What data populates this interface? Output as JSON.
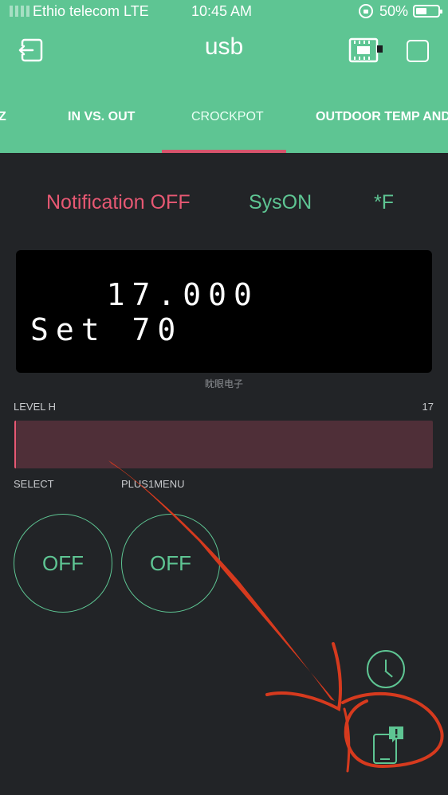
{
  "status_bar": {
    "carrier": "Ethio telecom LTE",
    "time": "10:45 AM",
    "battery": "50%"
  },
  "header": {
    "title": "usb",
    "icons": [
      "exit-icon",
      "device-icon",
      "add-widget-icon"
    ]
  },
  "tabs": [
    {
      "label": "Z"
    },
    {
      "label": "IN VS. OUT"
    },
    {
      "label": "CROCKPOT",
      "active": true
    },
    {
      "label": "OUTDOOR TEMP AND"
    }
  ],
  "status_labels": {
    "notification": "Notification OFF",
    "system": "SysON",
    "unit": "*F"
  },
  "lcd": {
    "line1": "   17.000",
    "line2": "Set 70",
    "caption": "眈眼电子"
  },
  "level": {
    "label": "LEVEL H",
    "value": "17",
    "fill_fraction": 0.004
  },
  "buttons": [
    {
      "label": "SELECT",
      "state": "OFF"
    },
    {
      "label": "PLUS1MENU",
      "state": "OFF"
    }
  ],
  "colors": {
    "header_bg": "#5ec593",
    "app_bg": "#222427",
    "accent_red": "#e75873",
    "accent_green": "#5ec593",
    "annotation_red": "#d63a1e"
  }
}
